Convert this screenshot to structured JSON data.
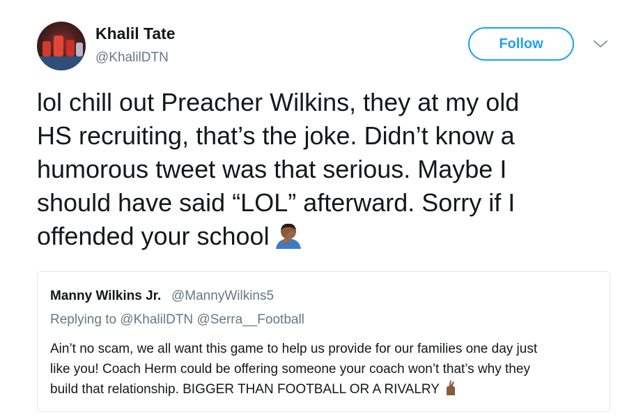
{
  "author": {
    "name": "Khalil Tate",
    "handle": "@KhalilDTN"
  },
  "follow_button": {
    "label": "Follow"
  },
  "menu": {
    "icon": "chevron-down-icon"
  },
  "tweet": {
    "lines": [
      "lol chill out Preacher Wilkins, they at my old",
      "HS recruiting, that’s the joke. Didn’t know a",
      "humorous tweet was that serious. Maybe I",
      "should have said “LOL” afterward. Sorry if I",
      "offended your school"
    ],
    "emoji": "facepalm-emoji"
  },
  "quoted_tweet": {
    "name": "Manny Wilkins Jr.",
    "handle": "@MannyWilkins5",
    "replying_to": "Replying to @KhalilDTN @Serra__Football",
    "lines": [
      "Ain’t no scam, we all want this game to help us provide for our families one day just",
      "like you! Coach Herm could be offering someone your coach won’t that’s why they",
      "build that relationship.  BIGGER THAN FOOTBALL OR A RIVALRY"
    ],
    "emoji": "crossed-fingers-emoji"
  },
  "colors": {
    "accent": "#1da1f2",
    "text": "#14171a",
    "secondary": "#657786",
    "border": "#e1e8ed"
  }
}
